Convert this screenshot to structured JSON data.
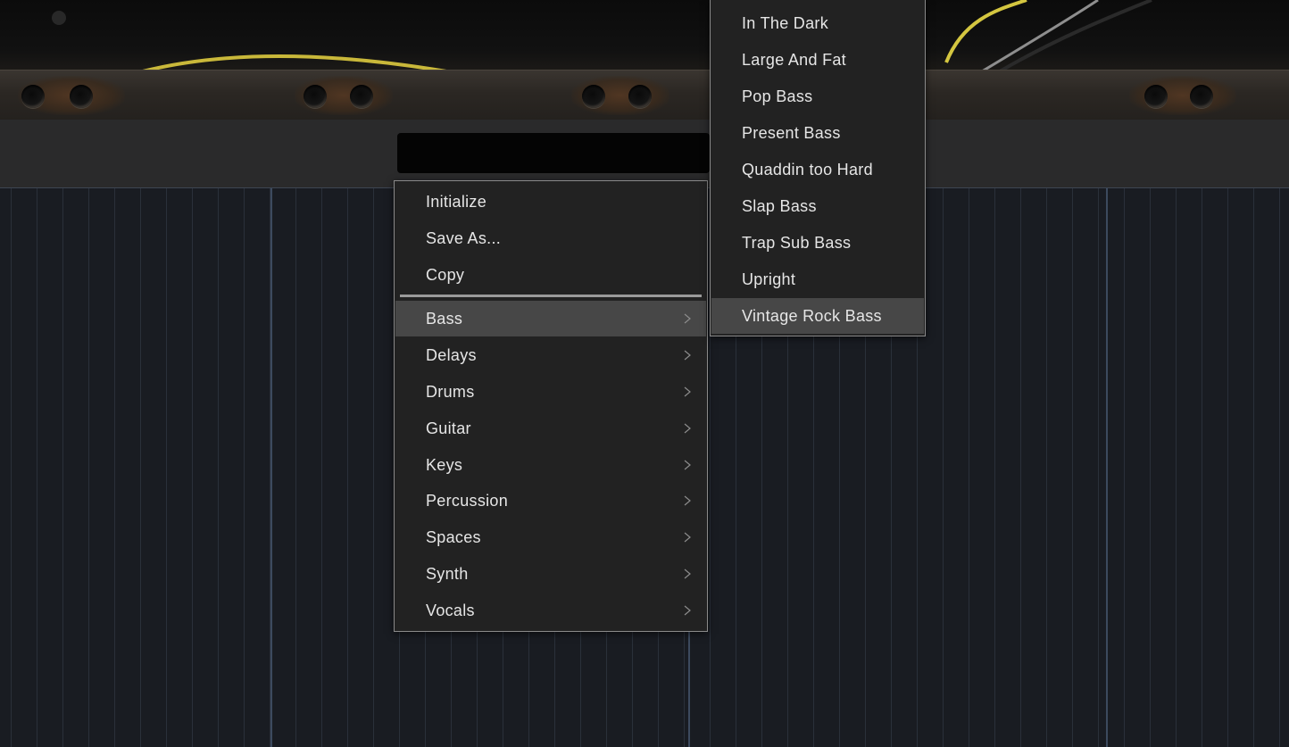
{
  "preset_display": "",
  "context_menu": {
    "items": [
      {
        "label": "Initialize"
      },
      {
        "label": "Save As..."
      },
      {
        "label": "Copy"
      }
    ],
    "categories": [
      {
        "label": "Bass",
        "active": true
      },
      {
        "label": "Delays"
      },
      {
        "label": "Drums"
      },
      {
        "label": "Guitar"
      },
      {
        "label": "Keys"
      },
      {
        "label": "Percussion"
      },
      {
        "label": "Spaces"
      },
      {
        "label": "Synth"
      },
      {
        "label": "Vocals"
      }
    ]
  },
  "bass_submenu": {
    "items": [
      {
        "label": "In The Dark"
      },
      {
        "label": "Large And Fat"
      },
      {
        "label": "Pop Bass"
      },
      {
        "label": "Present Bass"
      },
      {
        "label": "Quaddin too Hard"
      },
      {
        "label": "Slap Bass"
      },
      {
        "label": "Trap Sub Bass"
      },
      {
        "label": "Upright"
      },
      {
        "label": "Vintage Rock Bass",
        "highlighted": true
      }
    ]
  },
  "colors": {
    "menu_bg": "#222222",
    "menu_highlight": "#474747",
    "menu_border": "#8a8a8a",
    "grid_bg": "#191c22"
  }
}
